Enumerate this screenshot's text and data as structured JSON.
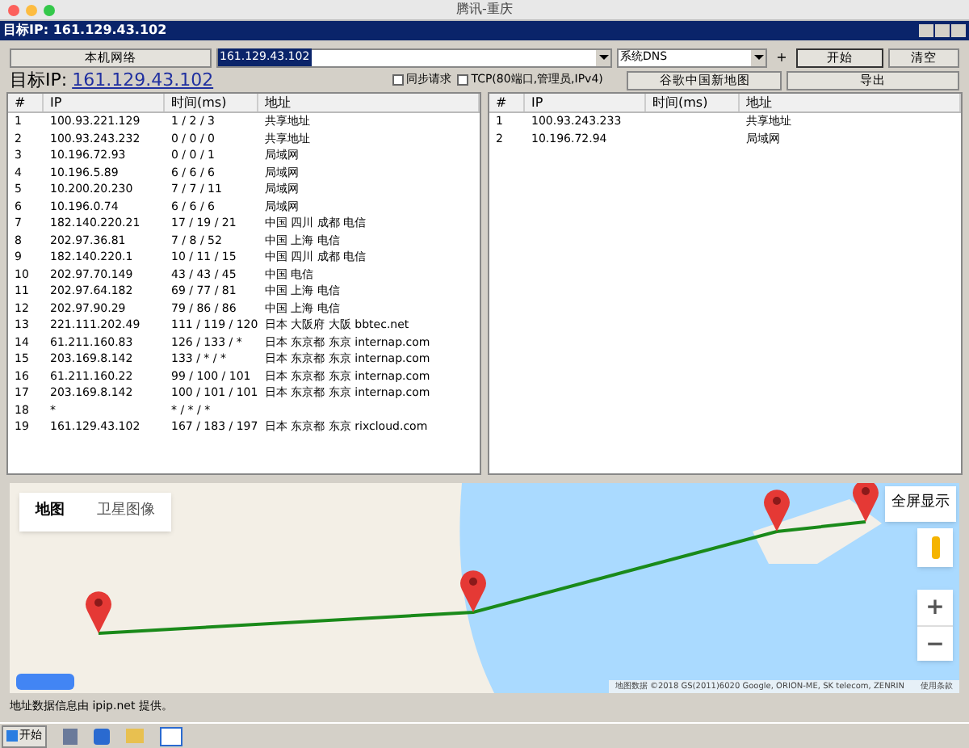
{
  "window": {
    "title": "腾讯-重庆"
  },
  "app_bar": {
    "title": "目标IP: 161.129.43.102"
  },
  "toolbar": {
    "local_button": "本机网络",
    "target_value": "161.129.43.102",
    "dns_value": "系统DNS",
    "plus_button": "+",
    "start_button": "开始",
    "clear_button": "清空"
  },
  "target_row": {
    "label": "目标IP:",
    "ip_link": "161.129.43.102",
    "options": [
      {
        "label": "同步请求",
        "checked": false
      },
      {
        "label": "TCP(80端口,管理员,IPv4)",
        "checked": false
      }
    ],
    "map_button": "谷歌中国新地图",
    "export_button": "导出"
  },
  "left_table": {
    "columns": [
      "#",
      "IP",
      "时间(ms)",
      "地址"
    ],
    "rows": [
      [
        "1",
        "100.93.221.129",
        "1 / 2 / 3",
        "共享地址"
      ],
      [
        "2",
        "100.93.243.232",
        "0 / 0 / 0",
        "共享地址"
      ],
      [
        "3",
        "10.196.72.93",
        "0 / 0 / 1",
        "局域网"
      ],
      [
        "4",
        "10.196.5.89",
        "6 / 6 / 6",
        "局域网"
      ],
      [
        "5",
        "10.200.20.230",
        "7 / 7 / 11",
        "局域网"
      ],
      [
        "6",
        "10.196.0.74",
        "6 / 6 / 6",
        "局域网"
      ],
      [
        "7",
        "182.140.220.21",
        "17 / 19 / 21",
        "中国 四川 成都 电信"
      ],
      [
        "8",
        "202.97.36.81",
        "7 / 8 / 52",
        "中国 上海 电信"
      ],
      [
        "9",
        "182.140.220.1",
        "10 / 11 / 15",
        "中国 四川 成都 电信"
      ],
      [
        "10",
        "202.97.70.149",
        "43 / 43 / 45",
        "中国 电信"
      ],
      [
        "11",
        "202.97.64.182",
        "69 / 77 / 81",
        "中国 上海 电信"
      ],
      [
        "12",
        "202.97.90.29",
        "79 / 86 / 86",
        "中国 上海 电信"
      ],
      [
        "13",
        "221.111.202.49",
        "111 / 119 / 120",
        "日本 大阪府 大阪 bbtec.net"
      ],
      [
        "14",
        "61.211.160.83",
        "126 / 133 / *",
        "日本 东京都 东京 internap.com"
      ],
      [
        "15",
        "203.169.8.142",
        "133 / * / *",
        "日本 东京都 东京 internap.com"
      ],
      [
        "16",
        "61.211.160.22",
        "99 / 100 / 101",
        "日本 东京都 东京 internap.com"
      ],
      [
        "17",
        "203.169.8.142",
        "100 / 101 / 101",
        "日本 东京都 东京 internap.com"
      ],
      [
        "18",
        "*",
        "* / * / *",
        ""
      ],
      [
        "19",
        "161.129.43.102",
        "167 / 183 / 197",
        "日本 东京都 东京 rixcloud.com"
      ]
    ]
  },
  "right_table": {
    "columns": [
      "#",
      "IP",
      "时间(ms)",
      "地址"
    ],
    "rows": [
      [
        "1",
        "100.93.243.233",
        "",
        "共享地址"
      ],
      [
        "2",
        "10.196.72.94",
        "",
        "局域网"
      ]
    ]
  },
  "map": {
    "tabs": [
      {
        "label": "地图",
        "selected": true
      },
      {
        "label": "卫星图像",
        "selected": false
      }
    ],
    "fullscreen_button": "全屏显示",
    "zoom_in": "+",
    "zoom_out": "−",
    "attribution": "地图数据 ©2018 GS(2011)6020 Google, ORION-ME, SK telecom, ZENRIN",
    "terms_link": "使用条款"
  },
  "footnote": "地址数据信息由 ipip.net 提供。",
  "taskbar": {
    "start_button": "开始"
  }
}
